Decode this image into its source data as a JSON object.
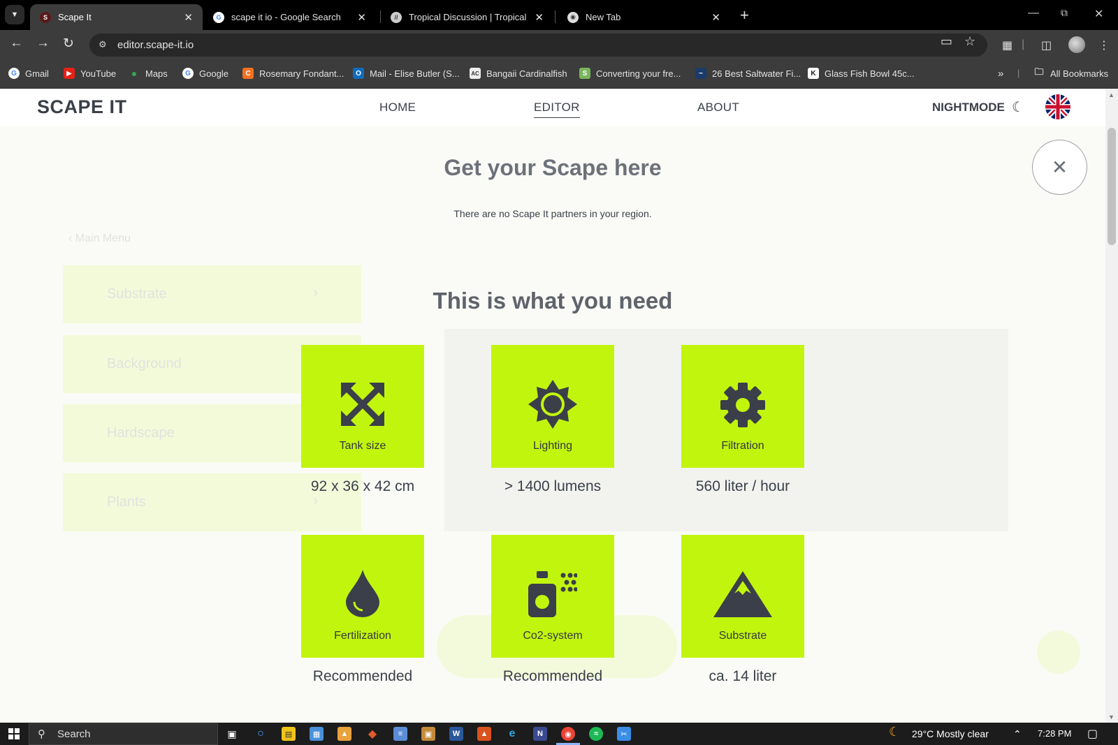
{
  "browser": {
    "tabs": [
      {
        "title": "Scape It",
        "favicon": "scape-it-favicon",
        "active": true
      },
      {
        "title": "scape it io - Google Search",
        "favicon": "google-icon"
      },
      {
        "title": "Tropical Discussion | Tropical Fis",
        "favicon": "forum-icon"
      },
      {
        "title": "New Tab",
        "favicon": "chrome-icon"
      }
    ],
    "url": "editor.scape-it.io",
    "bookmarks": [
      {
        "label": "Gmail",
        "icon": "google-icon"
      },
      {
        "label": "YouTube",
        "icon": "youtube-icon"
      },
      {
        "label": "Maps",
        "icon": "maps-icon"
      },
      {
        "label": "Google",
        "icon": "google-icon"
      },
      {
        "label": "Rosemary Fondant...",
        "icon": "c-icon"
      },
      {
        "label": "Mail - Elise Butler (S...",
        "icon": "outlook-icon"
      },
      {
        "label": "Bangaii Cardinalfish",
        "icon": "ac-icon"
      },
      {
        "label": "Converting your fre...",
        "icon": "shopify-icon"
      },
      {
        "label": "26 Best Saltwater Fi...",
        "icon": "site-icon"
      },
      {
        "label": "Glass Fish Bowl 45c...",
        "icon": "k-icon"
      }
    ],
    "all_bookmarks": "All Bookmarks"
  },
  "site": {
    "logo": "SCAPE IT",
    "nav": {
      "home": "HOME",
      "editor": "EDITOR",
      "about": "ABOUT",
      "nightmode": "NIGHTMODE"
    },
    "background": {
      "main_menu": "Main Menu",
      "items": [
        "Substrate",
        "Background",
        "Hardscape",
        "Plants"
      ]
    },
    "modal": {
      "title": "Get your Scape here",
      "partners_text": "There are no Scape It partners in your region.",
      "needs_title": "This is what you need",
      "cards": [
        {
          "label": "Tank size",
          "value": "92 x 36 x 42 cm",
          "icon": "resize-arrows-icon"
        },
        {
          "label": "Lighting",
          "value": "> 1400 lumens",
          "icon": "sun-icon"
        },
        {
          "label": "Filtration",
          "value": "560 liter / hour",
          "icon": "gear-icon"
        },
        {
          "label": "Fertilization",
          "value": "Recommended",
          "icon": "droplet-icon"
        },
        {
          "label": "Co2-system",
          "value": "Recommended",
          "icon": "co2-spray-icon"
        },
        {
          "label": "Substrate",
          "value": "ca. 14 liter",
          "icon": "mountain-icon"
        }
      ]
    },
    "accent_color": "#c2f50e",
    "text_color": "#3a3f49"
  },
  "taskbar": {
    "search_placeholder": "Search",
    "weather": "29°C  Mostly clear",
    "time": "7:28 PM"
  }
}
